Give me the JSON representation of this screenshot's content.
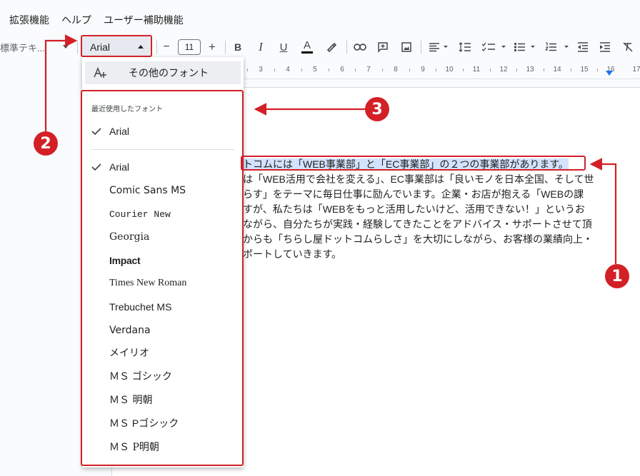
{
  "menubar": {
    "items": [
      "拡張機能",
      "ヘルプ",
      "ユーザー補助機能"
    ]
  },
  "toolbar": {
    "style_value": "標準テキ...",
    "font_value": "Arial",
    "font_size": "11",
    "minus": "−",
    "plus": "+",
    "bold": "B",
    "italic": "I",
    "underline": "U",
    "text_color": "A"
  },
  "ruler": {
    "ticks": [
      "3",
      "4",
      "5",
      "6",
      "7",
      "8",
      "9",
      "10",
      "11",
      "12",
      "13",
      "14",
      "15",
      "16",
      "17"
    ]
  },
  "document": {
    "lines": [
      "トコムには「WEB事業部」と「EC事業部」の２つの事業部があります。",
      "は「WEB活用で会社を変える」、EC事業部は「良いモノを日本全国、そして世",
      "らす」をテーマに毎日仕事に励んでいます。企業・お店が抱える「WEBの課",
      "すが、私たちは「WEBをもっと活用したいけど、活用できない！」というお",
      "ながら、自分たちが実践・経験してきたことをアドバイス・サポートさせて頂",
      "からも「ちらし屋ドットコムらしさ」を大切にしながら、お客様の業績向上・",
      "ポートしていきます。"
    ]
  },
  "font_menu": {
    "more_fonts_label": "その他のフォント",
    "recent_title": "最近使用したフォント",
    "recent": [
      "Arial"
    ],
    "fonts": [
      "Arial",
      "Comic Sans MS",
      "Courier New",
      "Georgia",
      "Impact",
      "Times New Roman",
      "Trebuchet MS",
      "Verdana",
      "メイリオ",
      "ＭＳ ゴシック",
      "ＭＳ 明朝",
      "ＭＳ Pゴシック",
      "ＭＳ P明朝"
    ],
    "selected": "Arial"
  },
  "callouts": {
    "one": "1",
    "two": "2",
    "three": "3"
  },
  "colors": {
    "accent_red": "#d32027",
    "highlight": "#d3e3fd",
    "blue_marker": "#1a73e8"
  }
}
